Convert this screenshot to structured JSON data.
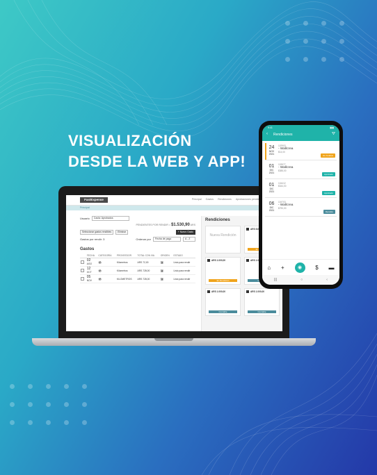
{
  "headline": {
    "line1": "VISUALIZACIÓN",
    "line2": "DESDE LA WEB Y APP!"
  },
  "web": {
    "logo": "FastExpense",
    "nav": [
      "Principal",
      "Gastos",
      "Rendiciones",
      "Aprobaciones pendientes",
      "Reportes"
    ],
    "section": "Principal",
    "wallet_label": "Usuario",
    "wallet_value": "Caola: Aprobados",
    "pending_label": "PENDIENTES POR RENDIR =",
    "pending_value": "$1.530,90",
    "pending_currency": "ARS",
    "select_button": "Seleccionar gastos rendibles",
    "delete_button": "Eliminar",
    "new_expense_button": "+ Nuevo Gasto",
    "count_label": "Gastos por rendir: 3",
    "sort_label": "Ordenar por",
    "sort_value": "Fecha de pago",
    "sort_order": "A - Z",
    "gastos_title": "Gastos",
    "table_headers": [
      "FECHA",
      "CATEGORÍA",
      "PROVEEDOR",
      "TOTAL CON IVA",
      "ORIGEN",
      "ESTADO"
    ],
    "rows": [
      {
        "day": "02",
        "month": "AGO",
        "category_icon": "car-icon",
        "provider": "Kilometros",
        "total": "ARS 72,00",
        "origin_icon": "camera-icon",
        "status": "Listo para rendir"
      },
      {
        "day": "12",
        "month": "OCT",
        "category_icon": "car-icon",
        "provider": "Kilometros",
        "total": "ARS 728,00",
        "origin_icon": "camera-icon",
        "status": "Listo para rendir"
      },
      {
        "day": "05",
        "month": "NOV",
        "category_icon": "car-icon",
        "provider": "KILOMETROS",
        "total": "ARS 728,00",
        "origin_icon": "camera-icon",
        "status": "Listo para rendir"
      }
    ],
    "rendiciones_title": "Rendiciones",
    "new_rendicion": "Nueva Rendición",
    "cards": [
      {
        "amount": "ARS 615,00",
        "status": "En Rendición",
        "color": "#f0a41c"
      },
      {
        "amount": "ARS 1.000,00",
        "status": "En Rendición",
        "color": "#f0a41c"
      },
      {
        "amount": "ARS 1.000,00",
        "status": "Contable",
        "color": "#4b8c9c"
      },
      {
        "amount": "ARS 1.000,00",
        "status": "Contable",
        "color": "#4b8c9c"
      },
      {
        "amount": "ARS 1.000,00",
        "status": "Contable",
        "color": "#4b8c9c"
      }
    ]
  },
  "app": {
    "status_time": "9:41",
    "title": "Rendiciones",
    "items": [
      {
        "day": "24",
        "month": "NOV",
        "year": "2021",
        "name": "- Wallcrea",
        "code": "102903",
        "amount": "$14,00",
        "status": "En Análisis",
        "color": "#f0a41c"
      },
      {
        "day": "01",
        "month": "DIC",
        "year": "2021",
        "name": "- Wallcrea",
        "code": "103577",
        "amount": "$385,00",
        "status": "Aprobado",
        "color": "#1fb3a9"
      },
      {
        "day": "01",
        "month": "DIC",
        "year": "2021",
        "name": "",
        "code": "104412",
        "amount": "$344,00",
        "status": "Aprobado",
        "color": "#1fb3a9"
      },
      {
        "day": "06",
        "month": "DIC",
        "year": "2021",
        "name": "- Wallcrea",
        "code": "104703",
        "amount": "$790,00",
        "status": "Rendido",
        "color": "#4b8c9c"
      }
    ],
    "tab_icons": [
      "home-icon",
      "plus-icon",
      "camera-icon",
      "dollar-icon",
      "wallet-icon"
    ]
  }
}
